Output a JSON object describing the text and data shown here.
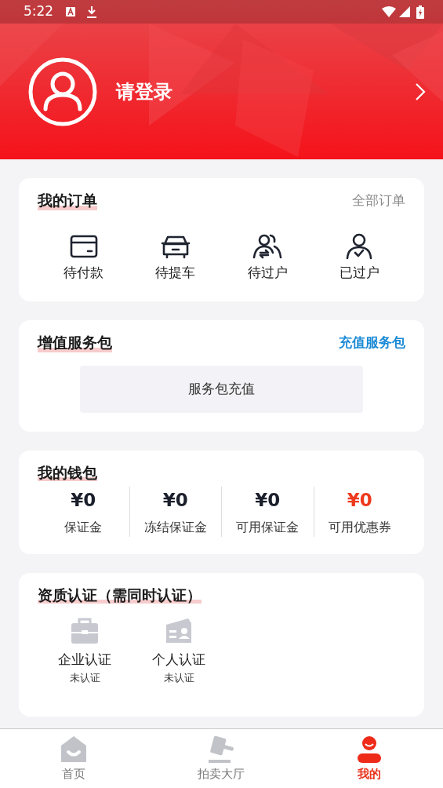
{
  "status_bar": {
    "time": "5:22"
  },
  "profile": {
    "login_label": "请登录"
  },
  "orders": {
    "title": "我的订单",
    "link": "全部订单",
    "items": [
      {
        "label": "待付款",
        "kind": "card"
      },
      {
        "label": "待提车",
        "kind": "car"
      },
      {
        "label": "待过户",
        "kind": "transfer"
      },
      {
        "label": "已过户",
        "kind": "done"
      }
    ]
  },
  "service": {
    "title": "增值服务包",
    "link": "充值服务包",
    "button": "服务包充值"
  },
  "wallet": {
    "title": "我的钱包",
    "items": [
      {
        "amount": "¥0",
        "label": "保证金",
        "highlight": false
      },
      {
        "amount": "¥0",
        "label": "冻结保证金",
        "highlight": false
      },
      {
        "amount": "¥0",
        "label": "可用保证金",
        "highlight": false
      },
      {
        "amount": "¥0",
        "label": "可用优惠券",
        "highlight": true
      }
    ]
  },
  "qualification": {
    "title": "资质认证（需同时认证）",
    "items": [
      {
        "label": "企业认证",
        "status": "未认证",
        "kind": "company"
      },
      {
        "label": "个人认证",
        "status": "未认证",
        "kind": "personal"
      }
    ]
  },
  "tab_bar": [
    {
      "label": "首页",
      "kind": "home",
      "selected": false
    },
    {
      "label": "拍卖大厅",
      "kind": "auction",
      "selected": false
    },
    {
      "label": "我的",
      "kind": "me",
      "selected": true
    }
  ]
}
